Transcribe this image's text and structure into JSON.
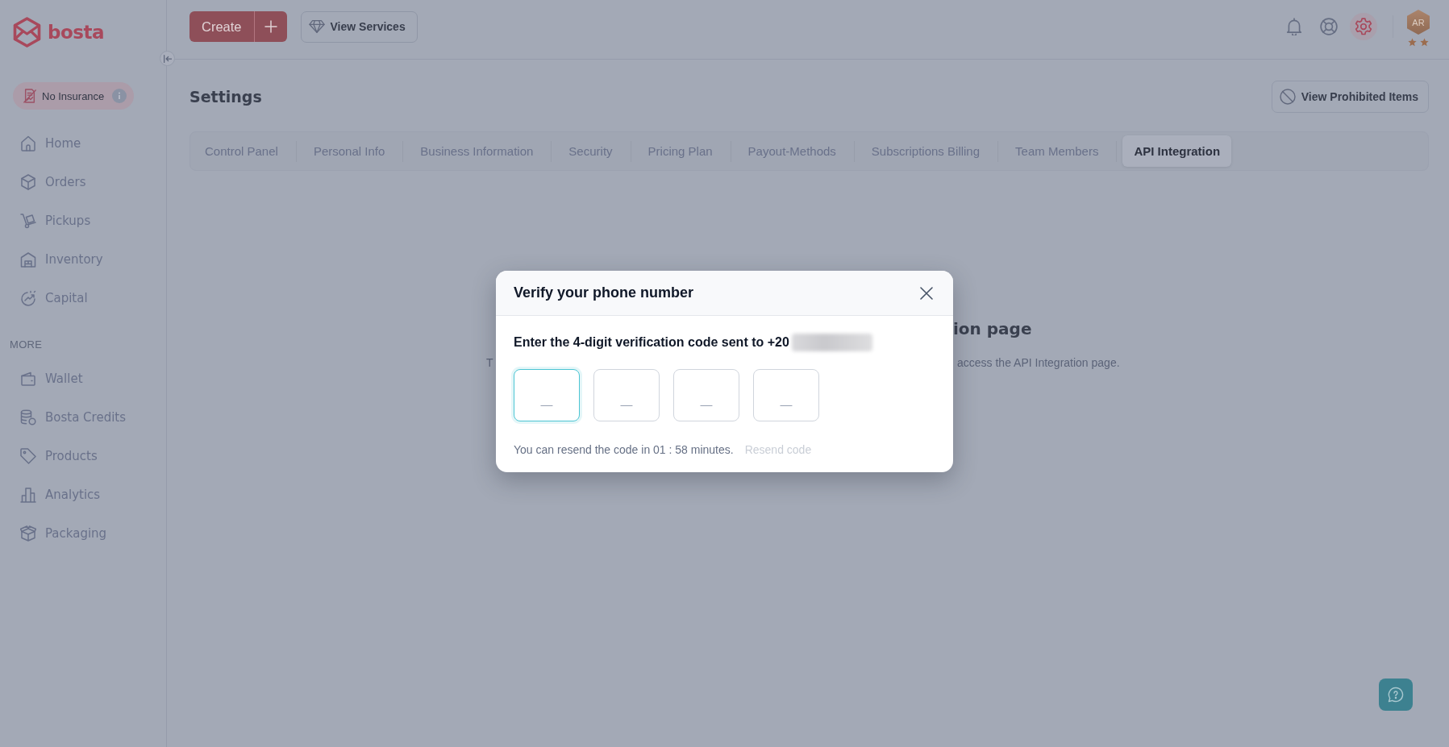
{
  "sidebar": {
    "brand": "bosta",
    "insurance_badge": {
      "label": "No Insurance"
    },
    "items": [
      {
        "label": "Home",
        "selected": false
      },
      {
        "label": "Orders",
        "selected": false
      },
      {
        "label": "Pickups",
        "selected": false
      },
      {
        "label": "Inventory",
        "selected": false
      },
      {
        "label": "Capital",
        "selected": false
      }
    ],
    "sections": [
      {
        "title": "MORE",
        "items": [
          {
            "label": "Wallet",
            "selected": false
          },
          {
            "label": "Bosta Credits",
            "selected": false
          },
          {
            "label": "Products",
            "selected": false
          },
          {
            "label": "Analytics",
            "selected": false
          },
          {
            "label": "Packaging",
            "selected": false
          }
        ]
      }
    ]
  },
  "header": {
    "create_button": {
      "label": "Create"
    },
    "services_button": {
      "label": "View Services"
    },
    "icons": [
      {
        "kind": "bell",
        "selected": false
      },
      {
        "kind": "support",
        "selected": false
      },
      {
        "kind": "settings",
        "selected": true
      }
    ],
    "avatar": {
      "initials": "AR"
    }
  },
  "page": {
    "title": "Settings",
    "action_button": {
      "label": "View Prohibited Items"
    },
    "tabs": [
      {
        "label": "Control Panel",
        "selected": false
      },
      {
        "label": "Personal Info",
        "selected": false
      },
      {
        "label": "Business Information",
        "selected": false
      },
      {
        "label": "Security",
        "selected": false
      },
      {
        "label": "Pricing Plan",
        "selected": false
      },
      {
        "label": "Payout-Methods",
        "selected": false
      },
      {
        "label": "Subscriptions Billing",
        "selected": false
      },
      {
        "label": "Team Members",
        "selected": false
      },
      {
        "label": "API Integration",
        "selected": true
      }
    ],
    "empty_state": {
      "title_fragment": "ion page",
      "text_fragments": [
        "T",
        "access the API Integration page."
      ]
    }
  },
  "modal": {
    "title": "Verify your phone number",
    "prompt": "Enter the 4-digit verification code sent to +20",
    "code_inputs": [
      {
        "placeholder": "_",
        "focused": true
      },
      {
        "placeholder": "_",
        "focused": false
      },
      {
        "placeholder": "_",
        "focused": false
      },
      {
        "placeholder": "_",
        "focused": false
      }
    ],
    "resend_note": "You can resend the code in 01 : 58 minutes.",
    "resend_link": {
      "label": "Resend code",
      "disabled": true
    }
  }
}
